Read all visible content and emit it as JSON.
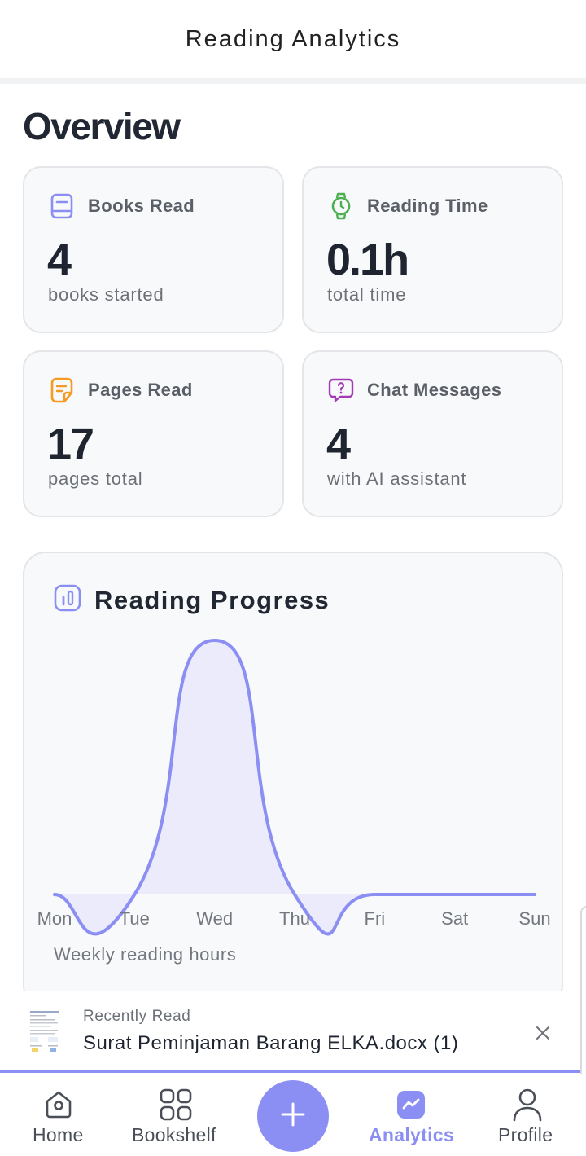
{
  "header": {
    "title": "Reading Analytics"
  },
  "overview": {
    "title": "Overview",
    "cards": [
      {
        "label": "Books Read",
        "value": "4",
        "sub": "books started",
        "icon": "book-icon",
        "color": "#8b8ef2"
      },
      {
        "label": "Reading Time",
        "value": "0.1h",
        "sub": "total time",
        "icon": "watch-icon",
        "color": "#4caf50"
      },
      {
        "label": "Pages Read",
        "value": "17",
        "sub": "pages total",
        "icon": "document-icon",
        "color": "#f59a23"
      },
      {
        "label": "Chat Messages",
        "value": "4",
        "sub": "with AI assistant",
        "icon": "chat-question-icon",
        "color": "#a23bb5"
      }
    ]
  },
  "chart": {
    "title": "Reading Progress",
    "caption": "Weekly reading hours",
    "icon": "bar-chart-icon"
  },
  "chart_data": {
    "type": "area",
    "categories": [
      "Mon",
      "Tue",
      "Wed",
      "Thu",
      "Fri",
      "Sat",
      "Sun"
    ],
    "values": [
      0,
      0,
      0.1,
      0,
      0,
      0,
      0
    ],
    "line_color": "#8b8ef2",
    "fill_color": "#ebebfb",
    "curve": "smooth"
  },
  "recent": {
    "kicker": "Recently Read",
    "title": "Surat Peminjaman Barang ELKA.docx (1)"
  },
  "nav": {
    "items": [
      {
        "label": "Home",
        "icon": "home-icon",
        "active": false
      },
      {
        "label": "Bookshelf",
        "icon": "grid-icon",
        "active": false
      },
      {
        "label": "Analytics",
        "icon": "analytics-icon",
        "active": true
      },
      {
        "label": "Profile",
        "icon": "user-icon",
        "active": false
      }
    ],
    "fab_icon": "plus-icon",
    "accent": "#8b8ef2"
  }
}
